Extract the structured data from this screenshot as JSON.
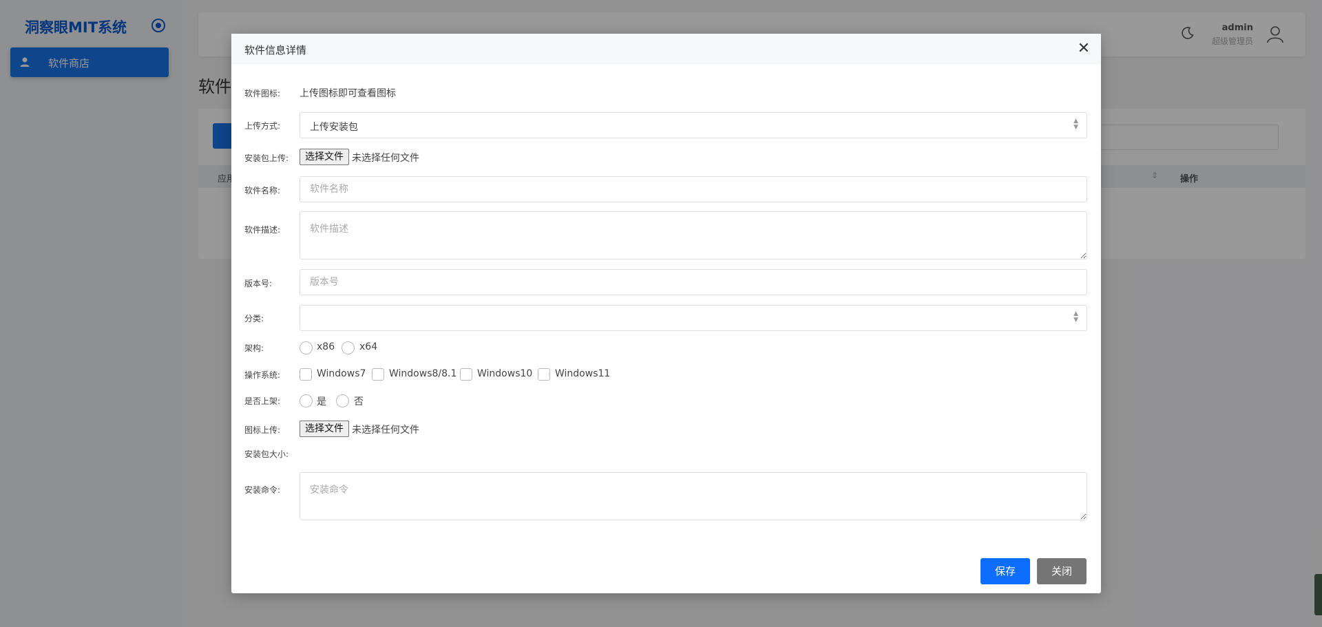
{
  "sidebar": {
    "brand": "洞察眼MIT系统",
    "items": [
      {
        "label": "软件商店",
        "icon": "user-icon"
      }
    ]
  },
  "topbar": {
    "user_name": "admin",
    "user_role": "超级管理员"
  },
  "page": {
    "heading": "软件",
    "table_col_app": "应用",
    "table_col_ops": "操作"
  },
  "modal": {
    "title": "软件信息详情",
    "close_glyph": "✕",
    "fields": {
      "icon": {
        "label": "软件图标:",
        "value": "上传图标即可查看图标"
      },
      "upload_method": {
        "label": "上传方式:",
        "value": "上传安装包"
      },
      "package_upload": {
        "label": "安装包上传:",
        "button": "选择文件",
        "status": "未选择任何文件"
      },
      "name": {
        "label": "软件名称:",
        "placeholder": "软件名称"
      },
      "description": {
        "label": "软件描述:",
        "placeholder": "软件描述"
      },
      "version": {
        "label": "版本号:",
        "placeholder": "版本号"
      },
      "category": {
        "label": "分类:",
        "value": ""
      },
      "arch": {
        "label": "架构:",
        "options": [
          "x86",
          "x64"
        ]
      },
      "os": {
        "label": "操作系统:",
        "options": [
          "Windows7",
          "Windows8/8.1",
          "Windows10",
          "Windows11"
        ]
      },
      "listed": {
        "label": "是否上架:",
        "options": [
          "是",
          "否"
        ]
      },
      "icon_upload": {
        "label": "图标上传:",
        "button": "选择文件",
        "status": "未选择任何文件"
      },
      "package_size": {
        "label": "安装包大小:"
      },
      "install_cmd": {
        "label": "安装命令:",
        "placeholder": "安装命令"
      }
    },
    "buttons": {
      "save": "保存",
      "close": "关闭"
    }
  }
}
